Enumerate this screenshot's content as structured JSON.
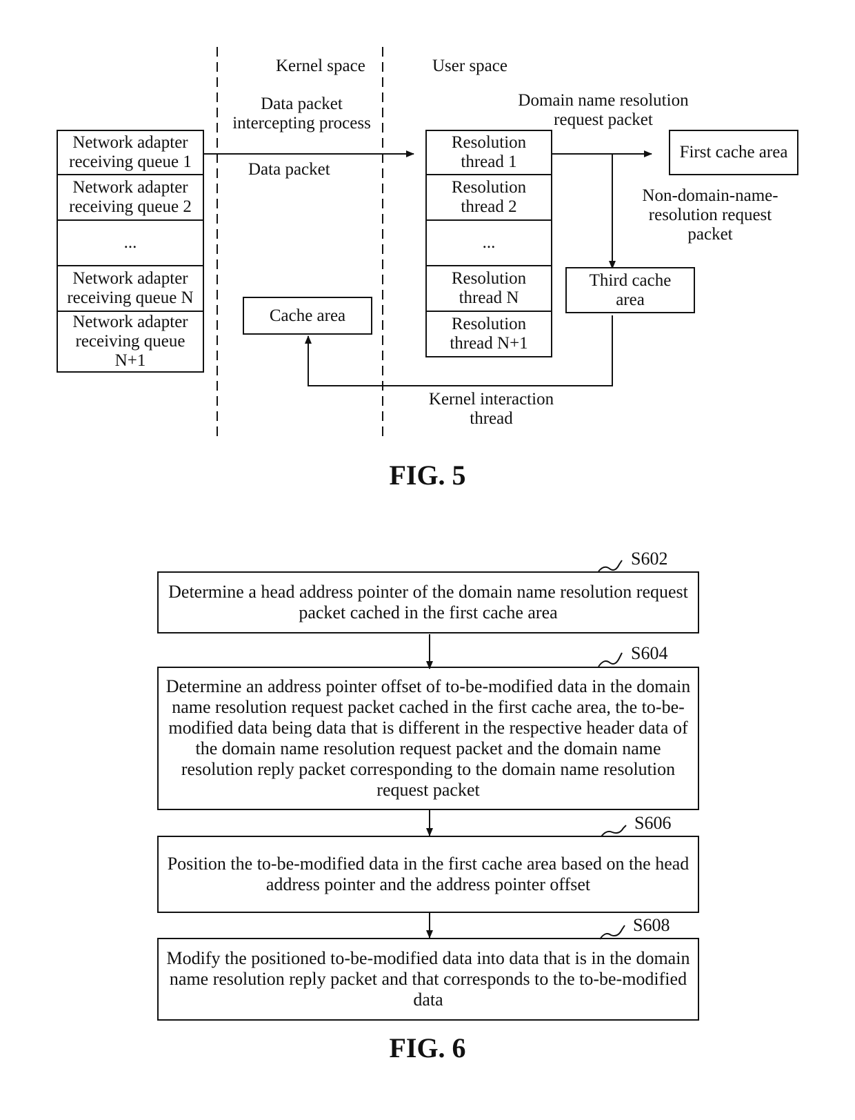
{
  "fig5": {
    "caption": "FIG. 5",
    "kernel_space_label": "Kernel space",
    "user_space_label": "User space",
    "intercept_label": "Data packet intercepting process",
    "data_packet_label": "Data packet",
    "dns_request_label": "Domain name resolution request packet",
    "non_dns_label": "Non-domain-name-resolution request packet",
    "kernel_interaction_label": "Kernel interaction thread",
    "queues": [
      "Network adapter receiving queue 1",
      "Network adapter receiving queue 2",
      "...",
      "Network adapter receiving queue N",
      "Network adapter receiving queue N+1"
    ],
    "threads": [
      "Resolution thread 1",
      "Resolution thread 2",
      "...",
      "Resolution thread N",
      "Resolution thread N+1"
    ],
    "first_cache": "First cache area",
    "third_cache": "Third cache area",
    "cache_area": "Cache area"
  },
  "fig6": {
    "caption": "FIG. 6",
    "steps": [
      {
        "id": "S602",
        "text": "Determine a head address pointer of the domain name resolution request packet cached in the first cache area"
      },
      {
        "id": "S604",
        "text": "Determine an address pointer offset of to-be-modified data in the domain name resolution request packet cached in the first cache area, the to-be-modified data being data that is different in the respective header data of the domain name resolution request packet and the domain name resolution reply packet corresponding to the domain name resolution request packet"
      },
      {
        "id": "S606",
        "text": "Position the to-be-modified data in the first cache area based on the head address pointer and the address pointer offset"
      },
      {
        "id": "S608",
        "text": "Modify the positioned to-be-modified data into data that is in the domain name resolution reply packet and that corresponds to the to-be-modified data"
      }
    ]
  }
}
